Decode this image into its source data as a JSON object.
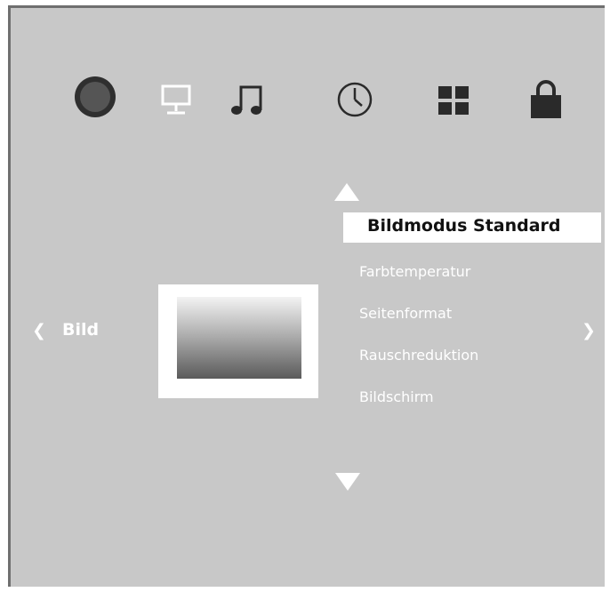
{
  "tabs": [
    {
      "name": "picture",
      "icon": "circle-icon",
      "active": true
    },
    {
      "name": "screen",
      "icon": "monitor-icon"
    },
    {
      "name": "sound",
      "icon": "music-note-icon"
    },
    {
      "name": "timer",
      "icon": "clock-icon"
    },
    {
      "name": "apps",
      "icon": "grid-icon"
    },
    {
      "name": "lock",
      "icon": "lock-icon"
    }
  ],
  "nav": {
    "left_glyph": "❮",
    "left_label": "Bild",
    "right_glyph": "❯"
  },
  "menu": {
    "selected": "Bildmodus Standard",
    "items": [
      "Farbtemperatur",
      "Seitenformat",
      "Rauschreduktion",
      "Bildschirm"
    ]
  },
  "colors": {
    "background": "#c8c8c8",
    "text": "#ffffff",
    "selected_bg": "#ffffff",
    "icon_dark": "#2a2a2a"
  }
}
